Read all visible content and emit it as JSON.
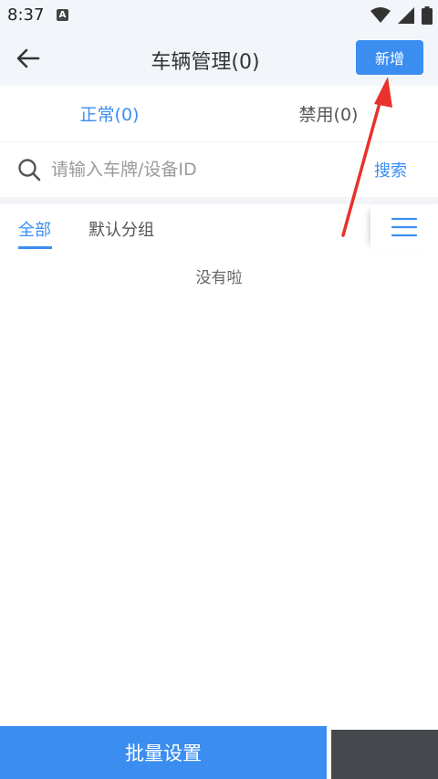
{
  "status_bar": {
    "time": "8:37",
    "app_badge": "A"
  },
  "header": {
    "title": "车辆管理(0)",
    "add_label": "新增"
  },
  "tabs": [
    {
      "label": "正常(0)",
      "active": true
    },
    {
      "label": "禁用(0)",
      "active": false
    }
  ],
  "search": {
    "placeholder": "请输入车牌/设备ID",
    "button": "搜索"
  },
  "group_tabs": [
    {
      "label": "全部",
      "active": true
    },
    {
      "label": "默认分组",
      "active": false
    }
  ],
  "empty_text": "没有啦",
  "bottom_button": "批量设置",
  "colors": {
    "accent": "#3b8ef0",
    "annotation_arrow": "#e8322b",
    "header_bg": "#f2f6fa"
  }
}
